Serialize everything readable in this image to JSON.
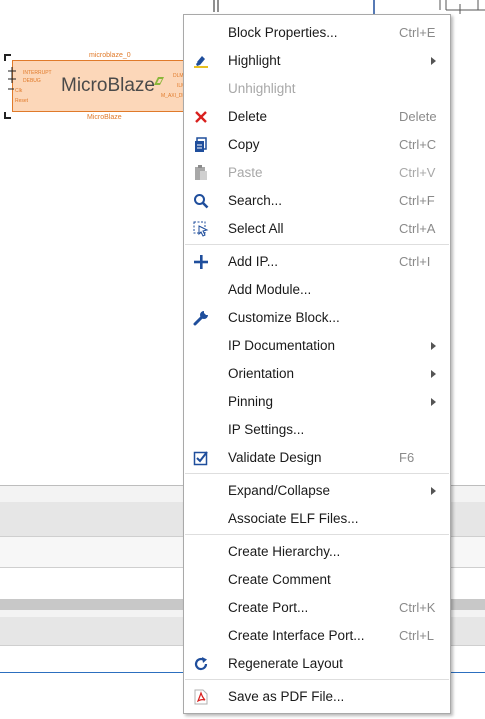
{
  "diagram": {
    "instance_name": "microblaze_0",
    "block_title": "MicroBlaze",
    "module_label": "MicroBlaze",
    "left_ports": [
      "INTERRUPT",
      "DEBUG",
      "Clk",
      "Reset"
    ],
    "right_ports": [
      "DLM",
      "ILM",
      "M_AXI_DP"
    ]
  },
  "context_menu": {
    "items": [
      {
        "label": "Block Properties...",
        "shortcut": "Ctrl+E",
        "icon": "none",
        "enabled": true,
        "submenu": false
      },
      {
        "label": "Highlight",
        "shortcut": "",
        "icon": "highlight-icon",
        "enabled": true,
        "submenu": true
      },
      {
        "label": "Unhighlight",
        "shortcut": "",
        "icon": "none",
        "enabled": false,
        "submenu": false
      },
      {
        "label": "Delete",
        "shortcut": "Delete",
        "icon": "delete-icon",
        "enabled": true,
        "submenu": false
      },
      {
        "label": "Copy",
        "shortcut": "Ctrl+C",
        "icon": "copy-icon",
        "enabled": true,
        "submenu": false
      },
      {
        "label": "Paste",
        "shortcut": "Ctrl+V",
        "icon": "paste-icon",
        "enabled": false,
        "submenu": false
      },
      {
        "label": "Search...",
        "shortcut": "Ctrl+F",
        "icon": "search-icon",
        "enabled": true,
        "submenu": false
      },
      {
        "label": "Select All",
        "shortcut": "Ctrl+A",
        "icon": "select-all-icon",
        "enabled": true,
        "submenu": false
      },
      {
        "label": "Add IP...",
        "shortcut": "Ctrl+I",
        "icon": "plus-icon",
        "enabled": true,
        "submenu": false
      },
      {
        "label": "Add Module...",
        "shortcut": "",
        "icon": "none",
        "enabled": true,
        "submenu": false
      },
      {
        "label": "Customize Block...",
        "shortcut": "",
        "icon": "wrench-icon",
        "enabled": true,
        "submenu": false
      },
      {
        "label": "IP Documentation",
        "shortcut": "",
        "icon": "none",
        "enabled": true,
        "submenu": true
      },
      {
        "label": "Orientation",
        "shortcut": "",
        "icon": "none",
        "enabled": true,
        "submenu": true
      },
      {
        "label": "Pinning",
        "shortcut": "",
        "icon": "none",
        "enabled": true,
        "submenu": true
      },
      {
        "label": "IP Settings...",
        "shortcut": "",
        "icon": "none",
        "enabled": true,
        "submenu": false
      },
      {
        "label": "Validate Design",
        "shortcut": "F6",
        "icon": "validate-icon",
        "enabled": true,
        "submenu": false
      },
      {
        "label": "Expand/Collapse",
        "shortcut": "",
        "icon": "none",
        "enabled": true,
        "submenu": true
      },
      {
        "label": "Associate ELF Files...",
        "shortcut": "",
        "icon": "none",
        "enabled": true,
        "submenu": false
      },
      {
        "label": "Create Hierarchy...",
        "shortcut": "",
        "icon": "none",
        "enabled": true,
        "submenu": false
      },
      {
        "label": "Create Comment",
        "shortcut": "",
        "icon": "none",
        "enabled": true,
        "submenu": false
      },
      {
        "label": "Create Port...",
        "shortcut": "Ctrl+K",
        "icon": "none",
        "enabled": true,
        "submenu": false
      },
      {
        "label": "Create Interface Port...",
        "shortcut": "Ctrl+L",
        "icon": "none",
        "enabled": true,
        "submenu": false
      },
      {
        "label": "Regenerate Layout",
        "shortcut": "",
        "icon": "refresh-icon",
        "enabled": true,
        "submenu": false
      },
      {
        "label": "Save as PDF File...",
        "shortcut": "",
        "icon": "pdf-icon",
        "enabled": true,
        "submenu": false
      }
    ]
  },
  "colors": {
    "block_fill": "#fcd7b9",
    "block_border": "#e07a2a",
    "icon_blue": "#1f4e9c",
    "delete_red": "#d9201e"
  }
}
